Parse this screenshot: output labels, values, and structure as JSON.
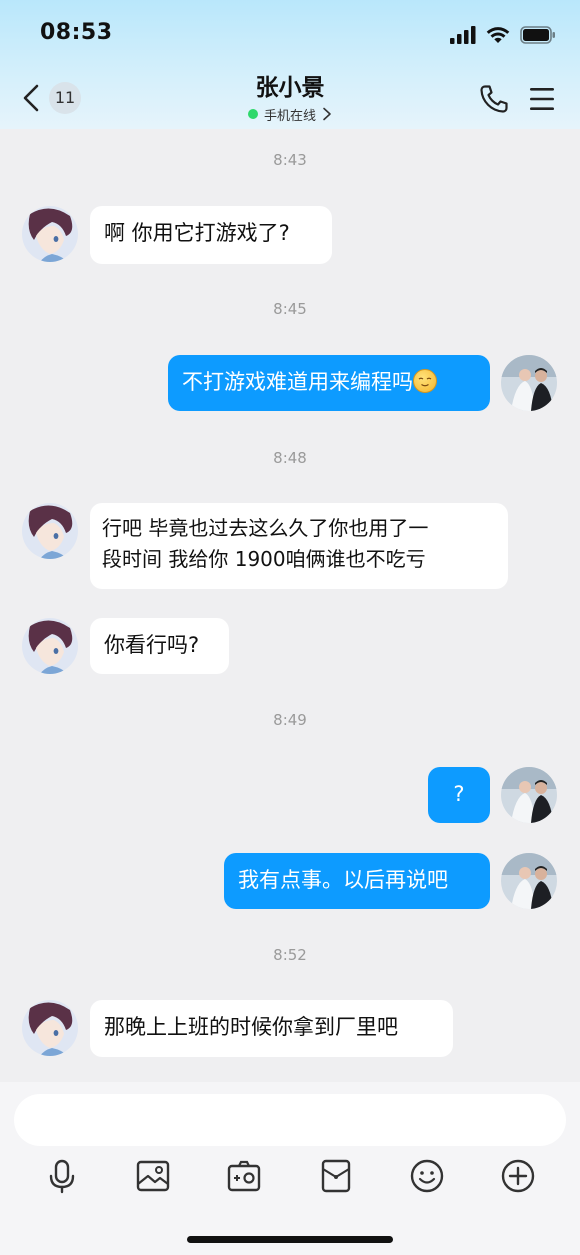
{
  "status_bar": {
    "time": "08:53"
  },
  "header": {
    "back_badge": "11",
    "title": "张小景",
    "status": "手机在线"
  },
  "messages": [
    {
      "type": "time",
      "text": "8:43"
    },
    {
      "type": "in",
      "text": "啊 你用它打游戏了?"
    },
    {
      "type": "time",
      "text": "8:45"
    },
    {
      "type": "out",
      "text": "不打游戏难道用来编程吗",
      "emoji": "relieved-face-emoji"
    },
    {
      "type": "time",
      "text": "8:48"
    },
    {
      "type": "in",
      "lines": [
        "行吧 毕竟也过去这么久了你也用了一",
        "段时间 我给你 1900咱俩谁也不吃亏"
      ]
    },
    {
      "type": "in",
      "text": "你看行吗?"
    },
    {
      "type": "time",
      "text": "8:49"
    },
    {
      "type": "out",
      "text": "?"
    },
    {
      "type": "out",
      "text": "我有点事。以后再说吧"
    },
    {
      "type": "time",
      "text": "8:52"
    },
    {
      "type": "in",
      "text": "那晚上上班的时候你拿到厂里吧"
    }
  ],
  "input": {
    "value": ""
  },
  "toolbar": {
    "icons": [
      "microphone-icon",
      "image-icon",
      "camera-icon",
      "red-packet-icon",
      "emoji-icon",
      "plus-icon"
    ]
  },
  "colors": {
    "outgoing_bubble": "#0d9bff",
    "incoming_bubble": "#ffffff",
    "background": "#efeff1",
    "online": "#2fd86b"
  }
}
